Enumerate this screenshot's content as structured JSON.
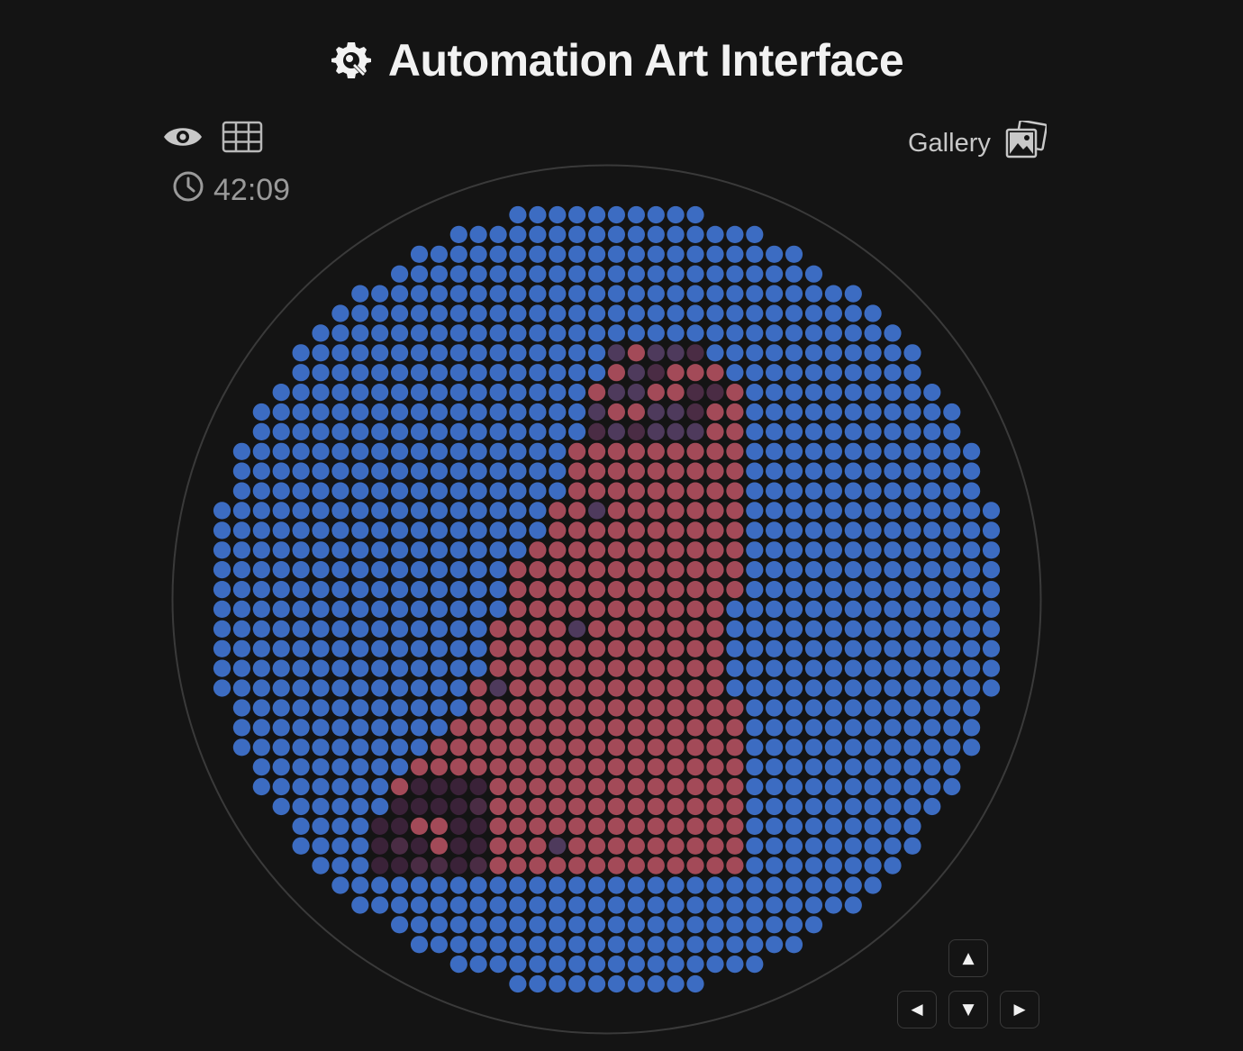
{
  "header": {
    "title": "Automation Art Interface",
    "logo_icon": "gear-brush-icon"
  },
  "toolbar": {
    "view_icon": "eye-icon",
    "grid_icon": "grid-icon",
    "timer_icon": "clock-icon",
    "timer_value": "42:09",
    "gallery_label": "Gallery",
    "gallery_icon": "gallery-images-icon"
  },
  "canvas": {
    "shape": "circle",
    "grid_columns": 40,
    "grid_rows": 40,
    "dot_colors": {
      "background": "#3c6cc2",
      "figure": "#a34a58",
      "shadow": "#4a2c44",
      "dark_shadow": "#3a2238",
      "muted": "#4e3a5c",
      "accent": "#2f4266"
    },
    "ring_color": "#3a3a3a",
    "bg_color": "#141414"
  },
  "controls": {
    "up_label": "▲",
    "left_label": "◀",
    "down_label": "▼",
    "right_label": "▶"
  }
}
